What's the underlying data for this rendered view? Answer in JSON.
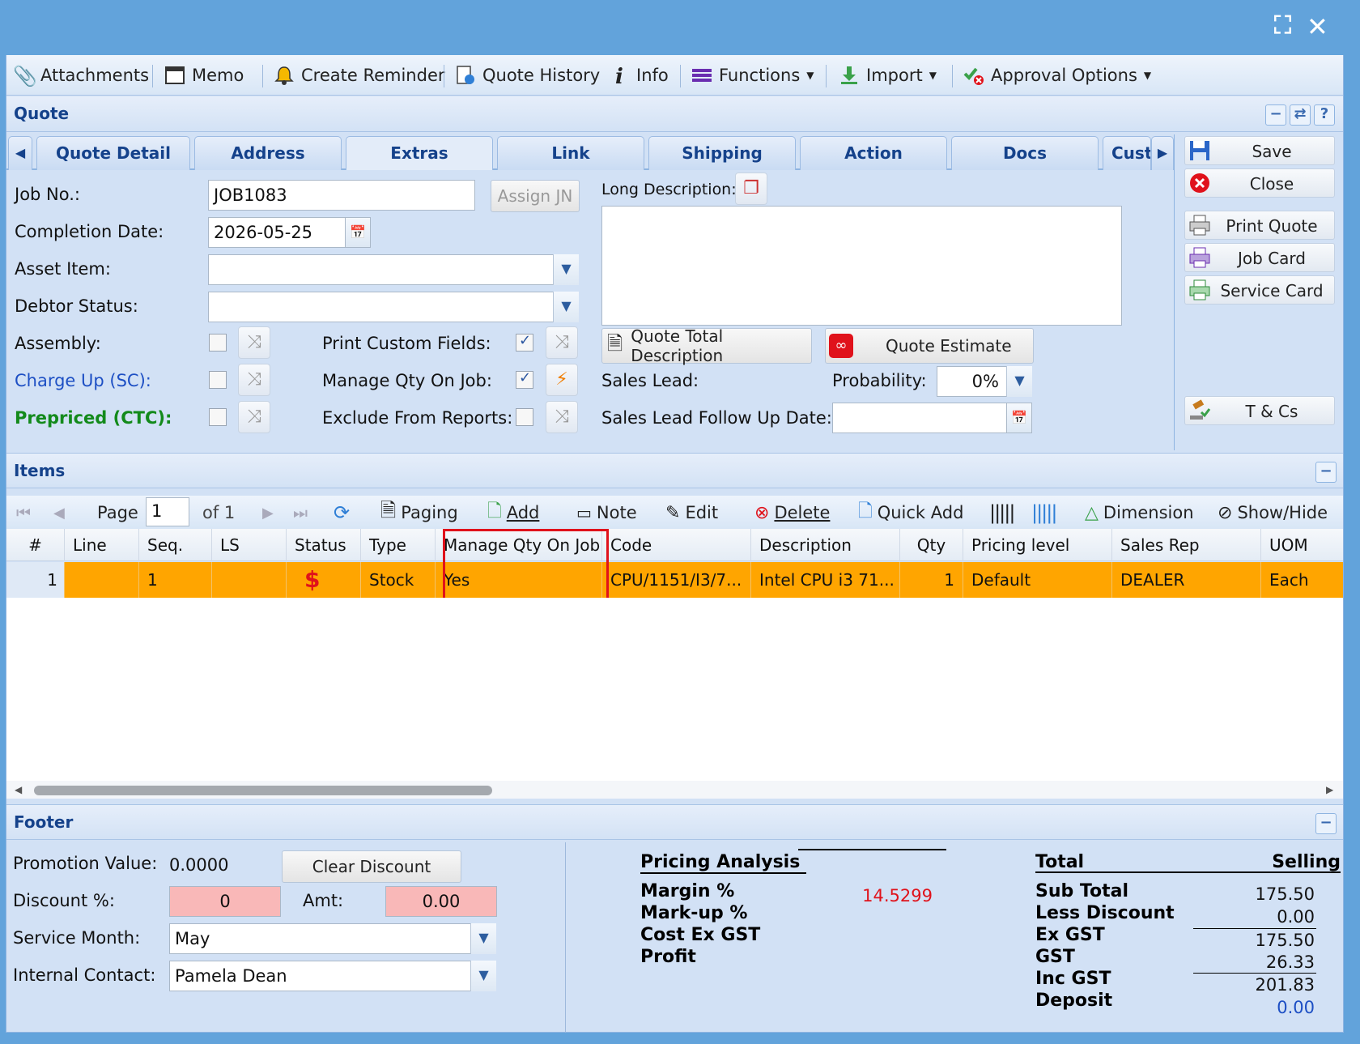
{
  "window": {
    "maximize_icon": "maximize-icon",
    "close_icon": "close-icon"
  },
  "toolbar": {
    "attachments": "Attachments",
    "memo": "Memo",
    "create_reminder": "Create Reminder",
    "quote_history": "Quote History",
    "info": "Info",
    "functions": "Functions",
    "import": "Import",
    "approval_options": "Approval Options"
  },
  "quote": {
    "section_title": "Quote",
    "tabs": [
      "Quote Detail",
      "Address",
      "Extras",
      "Link",
      "Shipping",
      "Action",
      "Docs",
      "Cust"
    ],
    "active_tab": "Extras",
    "job_no_label": "Job No.:",
    "job_no": "JOB1083",
    "assign_jn": "Assign JN",
    "completion_date_label": "Completion Date:",
    "completion_date": "2026-05-25",
    "asset_item_label": "Asset Item:",
    "asset_item": "",
    "debtor_status_label": "Debtor Status:",
    "debtor_status": "",
    "assembly_label": "Assembly:",
    "charge_up_label": "Charge Up (SC):",
    "prepriced_label": "Prepriced (CTC):",
    "print_custom_fields_label": "Print Custom Fields:",
    "manage_qty_label": "Manage Qty On Job:",
    "exclude_reports_label": "Exclude From Reports:",
    "long_description_label": "Long Description:",
    "long_description": "",
    "quote_total_description": "Quote Total Description",
    "quote_estimate": "Quote Estimate",
    "sales_lead_label": "Sales Lead:",
    "probability_label": "Probability:",
    "probability": "0%",
    "follow_up_label": "Sales Lead Follow Up Date:",
    "follow_up": ""
  },
  "side_buttons": {
    "save": "Save",
    "close": "Close",
    "print_quote": "Print Quote",
    "job_card": "Job Card",
    "service_card": "Service Card",
    "tcs": "T & Cs"
  },
  "items": {
    "section_title": "Items",
    "pager": {
      "page_label": "Page",
      "page": "1",
      "of": "of 1",
      "paging": "Paging",
      "add": "Add",
      "note": "Note",
      "edit": "Edit",
      "delete": "Delete",
      "quick_add": "Quick Add",
      "dimension": "Dimension",
      "show_hide": "Show/Hide"
    },
    "columns": [
      "#",
      "Line Ref.",
      "Seq. No.",
      "LS",
      "Status",
      "Type",
      "Manage Qty On Job",
      "Code",
      "Description",
      "Qty",
      "Pricing level",
      "Sales Rep",
      "UOM"
    ],
    "rows": [
      {
        "num": "1",
        "line_ref": "",
        "seq": "1",
        "ls": "",
        "status": "$",
        "type": "Stock",
        "manage_qty": "Yes",
        "code": "CPU/1151/I3/7...",
        "description": "Intel CPU i3 71...",
        "qty": "1",
        "pricing": "Default",
        "sales_rep": "DEALER",
        "uom": "Each"
      }
    ],
    "row_color": "#ffa500",
    "highlight_color": "#e0121b"
  },
  "footer": {
    "section_title": "Footer",
    "promotion_label": "Promotion Value:",
    "promotion": "0.0000",
    "clear_discount": "Clear Discount",
    "discount_label": "Discount %:",
    "discount": "0",
    "amt_label": "Amt:",
    "amt": "0.00",
    "service_month_label": "Service Month:",
    "service_month": "May",
    "internal_contact_label": "Internal Contact:",
    "internal_contact": "Pamela Dean",
    "pricing_analysis": "Pricing Analysis",
    "margin_label": "Margin %",
    "margin": "14.5299",
    "markup_label": "Mark-up %",
    "cost_label": "Cost Ex GST",
    "profit_label": "Profit",
    "total_label": "Total",
    "selling_label": "Selling",
    "sub_total_label": "Sub Total",
    "sub_total": "175.50",
    "less_discount_label": "Less Discount",
    "less_discount": "0.00",
    "ex_gst_label": "Ex GST",
    "ex_gst": "175.50",
    "gst_label": "GST",
    "gst": "26.33",
    "inc_gst_label": "Inc GST",
    "inc_gst": "201.83",
    "deposit_label": "Deposit",
    "deposit": "0.00"
  }
}
